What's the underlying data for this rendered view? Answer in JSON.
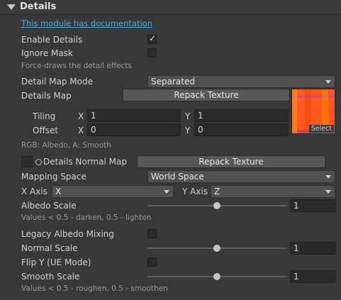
{
  "header": {
    "title": "Details"
  },
  "doc_link": "This module has documentation",
  "enable_details": {
    "label": "Enable Details",
    "checked": true,
    "mark": "✓"
  },
  "ignore_mask": {
    "label": "Ignore Mask",
    "checked": false
  },
  "ignore_mask_hint": "Force-draws the detail effects",
  "detail_map_mode": {
    "label": "Detail Map Mode",
    "value": "Separated"
  },
  "details_map": {
    "label": "Details Map",
    "repack_label": "Repack Texture",
    "select_label": "Select"
  },
  "tiling": {
    "label": "Tiling",
    "x_label": "X",
    "x": "1",
    "y_label": "Y",
    "y": "1"
  },
  "offset": {
    "label": "Offset",
    "x_label": "X",
    "x": "0",
    "y_label": "Y",
    "y": "0"
  },
  "rgb_hint": "RGB: Albedo, A: Smooth",
  "details_normal_map": {
    "label": "Details Normal Map",
    "repack_label": "Repack Texture"
  },
  "mapping_space": {
    "label": "Mapping Space",
    "value": "World Space"
  },
  "x_axis": {
    "label": "X Axis",
    "value": "X"
  },
  "y_axis": {
    "label": "Y Axis",
    "value": "Z"
  },
  "albedo_scale": {
    "label": "Albedo Scale",
    "value": "1",
    "fraction": 0.5
  },
  "albedo_hint": "Values < 0.5 - darken,  0.5 - lighten",
  "legacy_albedo_mixing": {
    "label": "Legacy Albedo Mixing",
    "checked": false
  },
  "normal_scale": {
    "label": "Normal Scale",
    "value": "1",
    "fraction": 0.5
  },
  "flip_y": {
    "label": "Flip Y (UE Mode)",
    "checked": false
  },
  "smooth_scale": {
    "label": "Smooth Scale",
    "value": "1",
    "fraction": 0.5
  },
  "smooth_hint": "Values < 0.5 - roughen,  0.5 - smoothen",
  "colors": {
    "background": "#383838",
    "link": "#4eaadc",
    "field": "#2a2a2a",
    "dropdown": "#515151"
  }
}
